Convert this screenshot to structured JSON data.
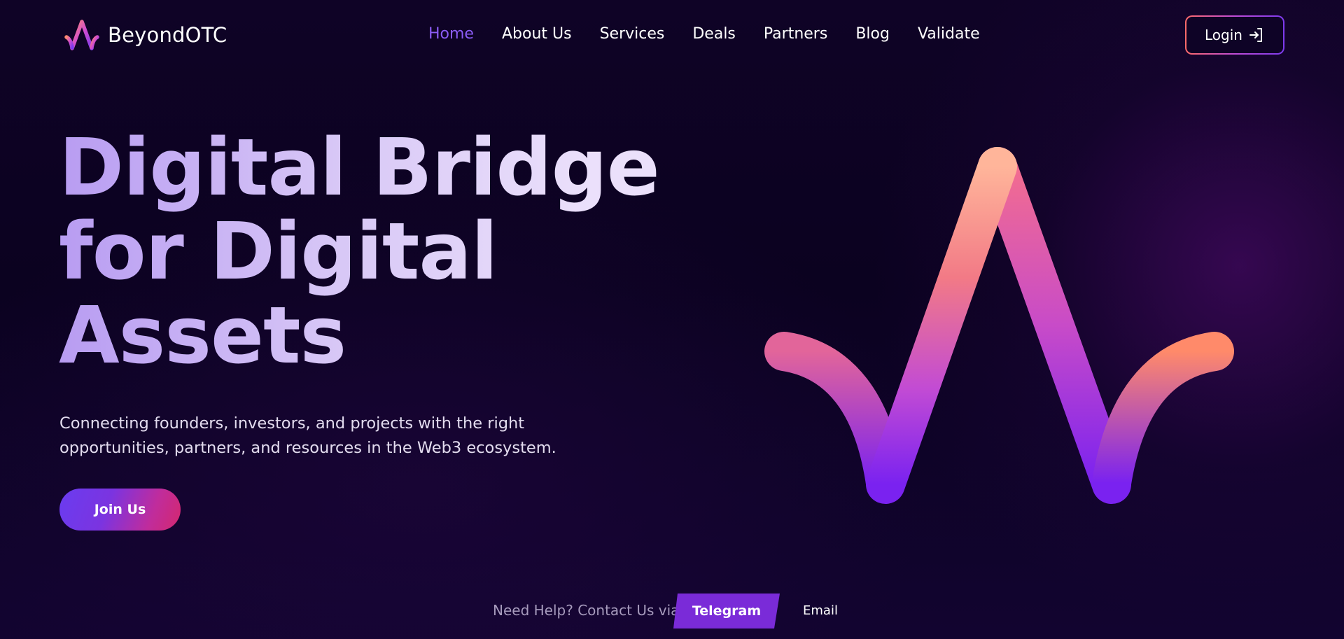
{
  "brand": {
    "name": "BeyondOTC",
    "logo_icon": "beyondotc-logo-icon"
  },
  "nav": {
    "items": [
      {
        "label": "Home",
        "active": true
      },
      {
        "label": "About Us",
        "active": false
      },
      {
        "label": "Services",
        "active": false
      },
      {
        "label": "Deals",
        "active": false
      },
      {
        "label": "Partners",
        "active": false
      },
      {
        "label": "Blog",
        "active": false
      },
      {
        "label": "Validate",
        "active": false
      }
    ],
    "active_color": "#8b5cf6"
  },
  "login": {
    "label": "Login",
    "icon": "login-arrow-icon"
  },
  "hero": {
    "title_line1": "Digital Bridge",
    "title_line2": "for Digital",
    "title_line3": "Assets",
    "subtitle_line1": "Connecting founders, investors, and projects with the right",
    "subtitle_line2": "opportunities, partners, and resources in the Web3 ecosystem.",
    "cta_label": "Join Us",
    "emblem_icon": "beyondotc-emblem-icon"
  },
  "contact": {
    "text": "Need Help? Contact Us via",
    "telegram_label": "Telegram",
    "email_label": "Email"
  },
  "colors": {
    "background": "#0c0220",
    "accent_purple": "#7c3aed",
    "accent_pink": "#e0457a",
    "telegram_bg": "#7a2bd8"
  }
}
